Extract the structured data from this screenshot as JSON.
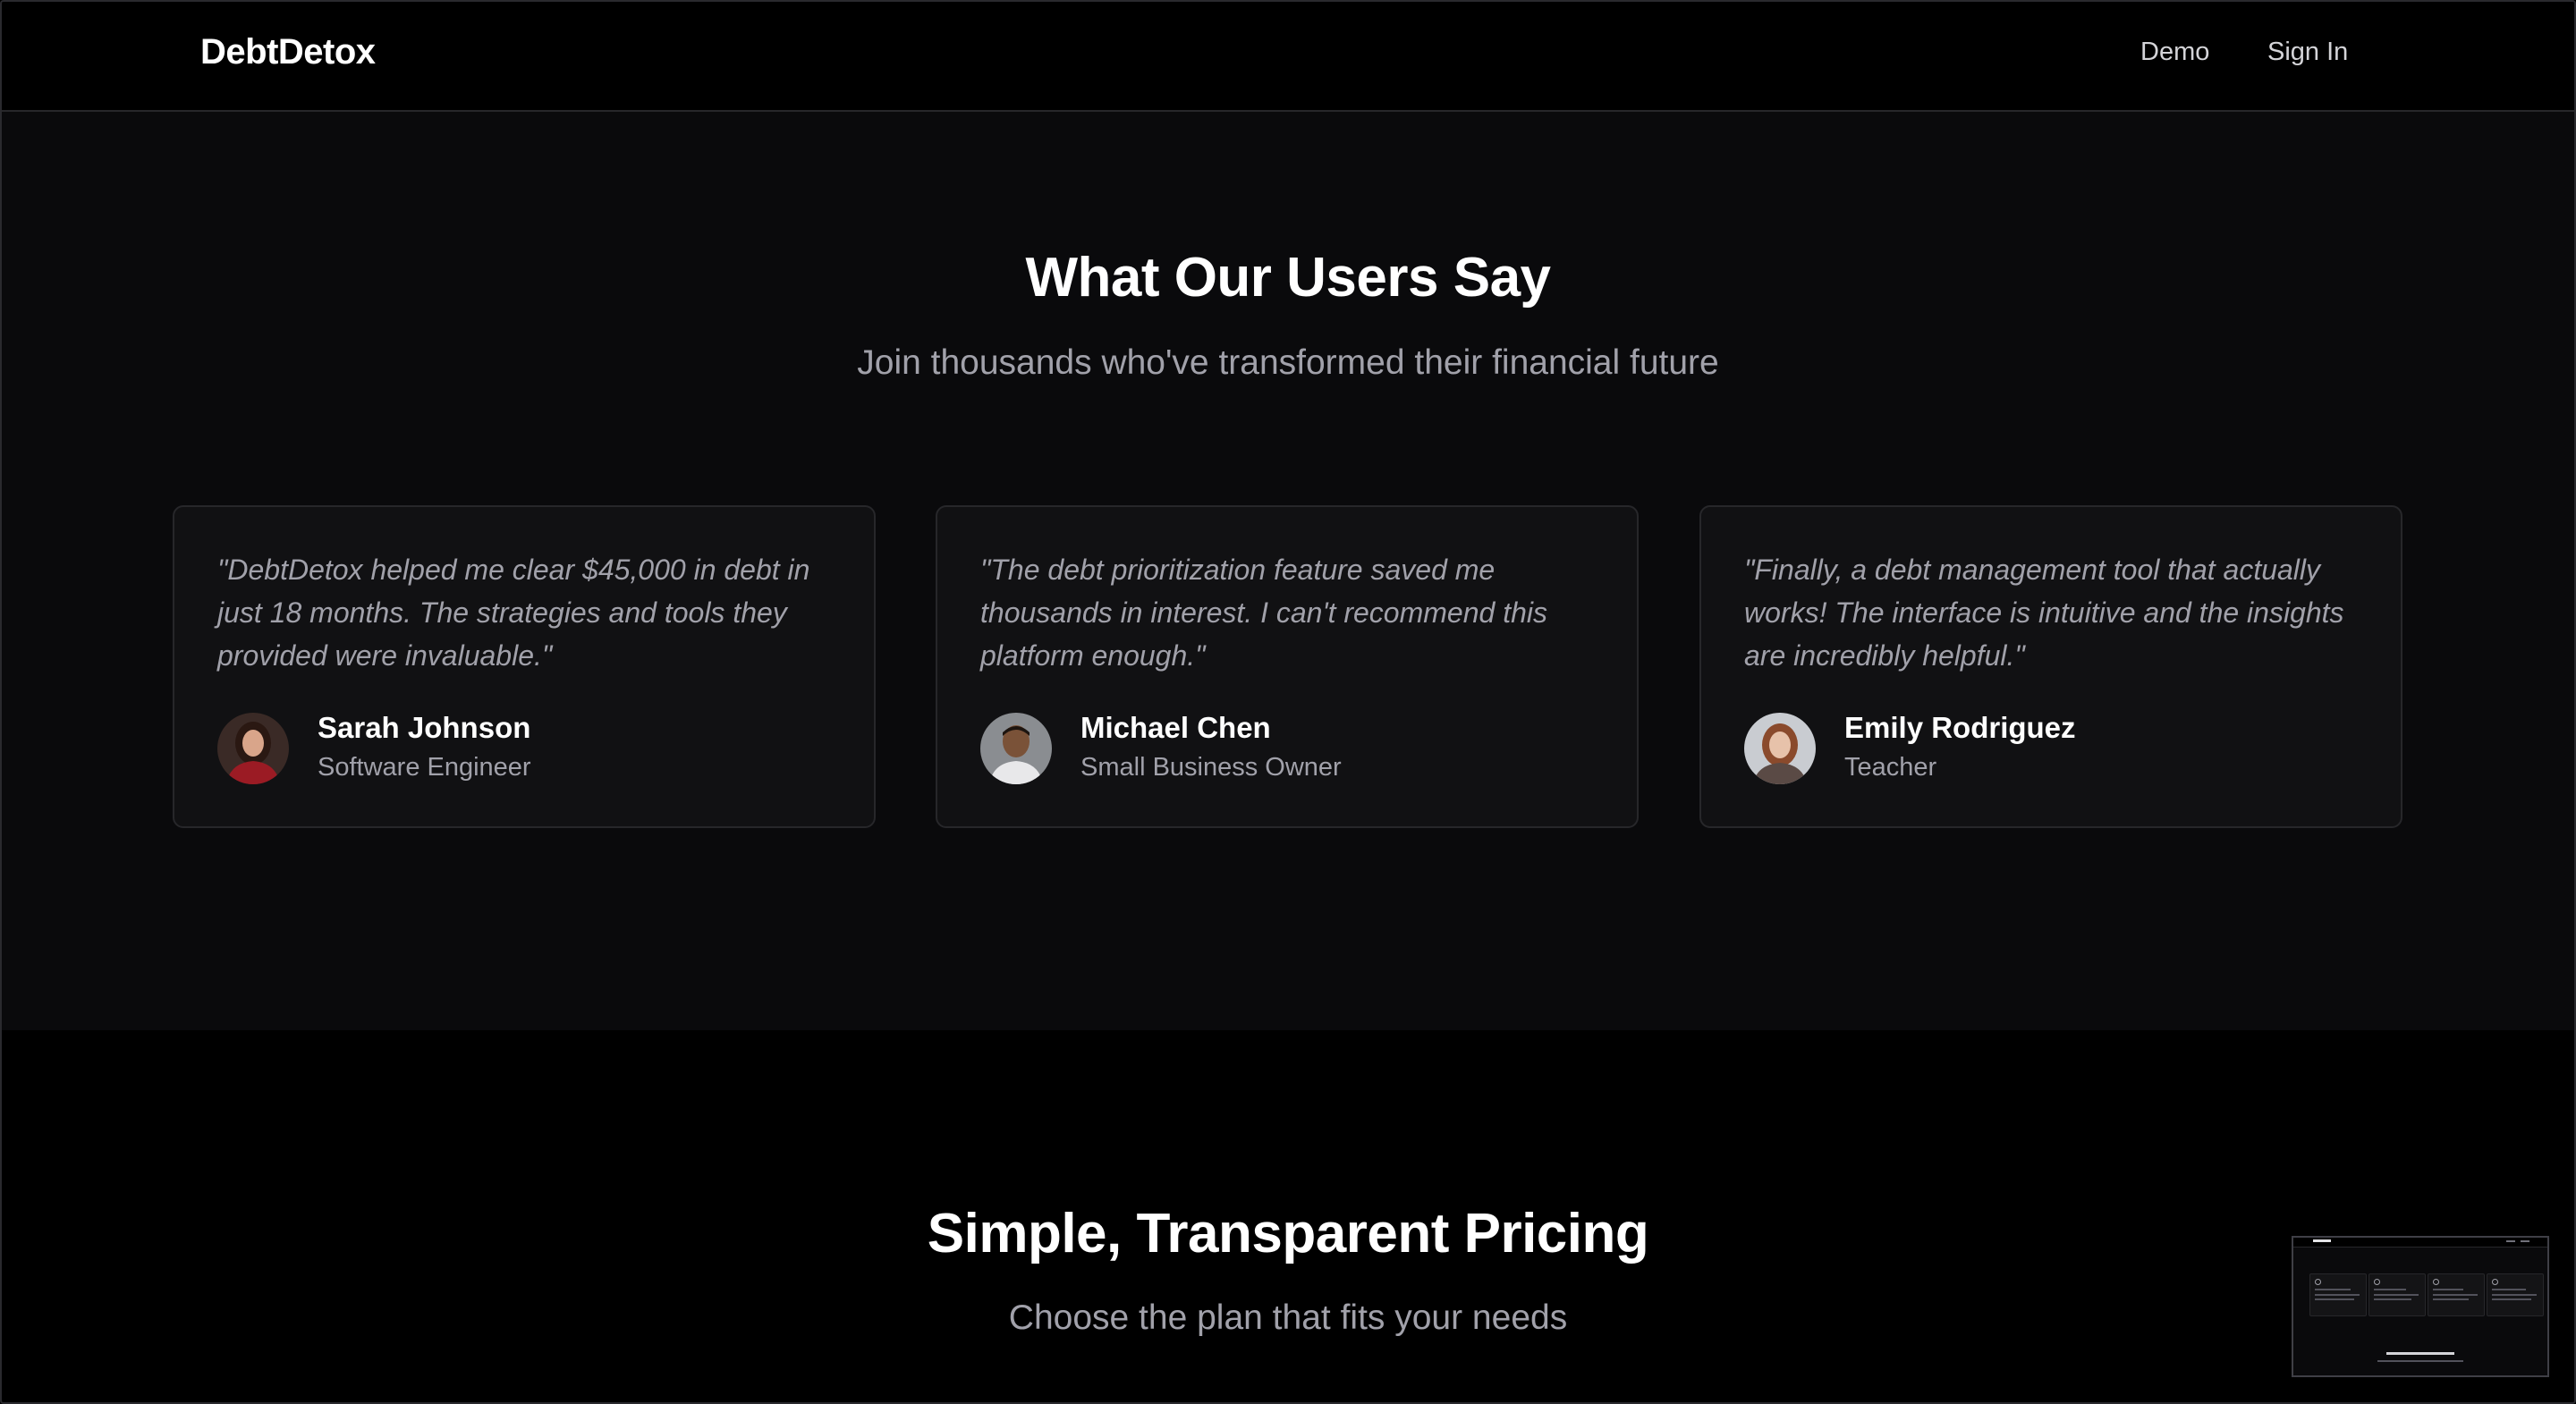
{
  "navbar": {
    "brand": "DebtDetox",
    "links": [
      "Demo",
      "Sign In"
    ]
  },
  "testimonials": {
    "title": "What Our Users Say",
    "subtitle": "Join thousands who've transformed their financial future",
    "items": [
      {
        "quote": "\"DebtDetox helped me clear $45,000 in debt in just 18 months. The strategies and tools they provided were invaluable.\"",
        "name": "Sarah Johnson",
        "role": "Software Engineer"
      },
      {
        "quote": "\"The debt prioritization feature saved me thousands in interest. I can't recommend this platform enough.\"",
        "name": "Michael Chen",
        "role": "Small Business Owner"
      },
      {
        "quote": "\"Finally, a debt management tool that actually works! The interface is intuitive and the insights are incredibly helpful.\"",
        "name": "Emily Rodriguez",
        "role": "Teacher"
      }
    ]
  },
  "pricing": {
    "title": "Simple, Transparent Pricing",
    "subtitle": "Choose the plan that fits your needs"
  },
  "colors": {
    "background": "#0a0a0c",
    "card": "#111113",
    "border": "#27272a",
    "muted_text": "#a1a1aa",
    "heading": "#ffffff"
  }
}
